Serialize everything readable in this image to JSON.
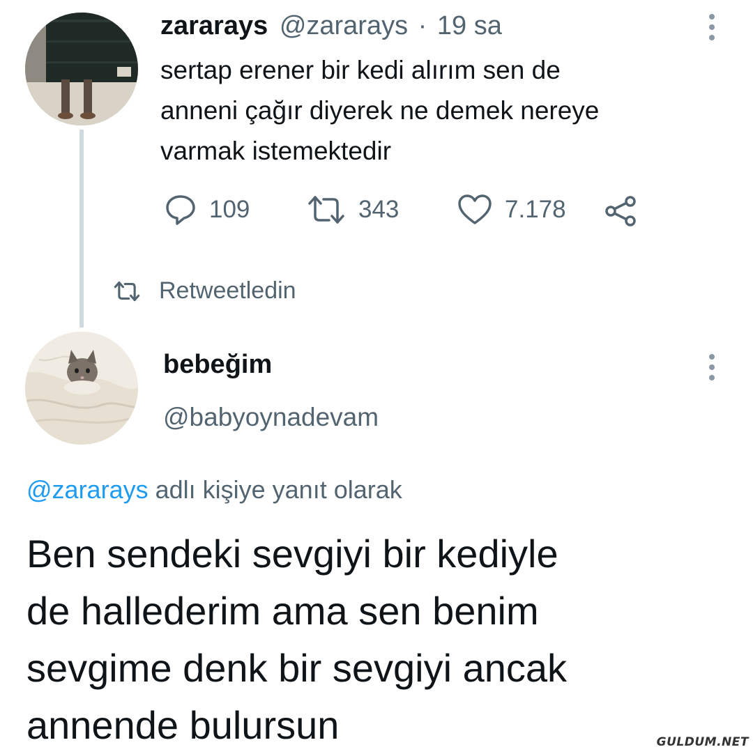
{
  "tweet1": {
    "display_name": "zararays",
    "handle": "@zararays",
    "separator": "·",
    "time": "19 sa",
    "text_lines": [
      "sertap erener bir kedi alırım sen de",
      "anneni çağır diyerek ne demek nereye",
      "varmak istemektedir"
    ],
    "replies": "109",
    "retweets": "343",
    "likes": "7.178",
    "icons": {
      "reply": "reply-icon",
      "retweet": "retweet-icon",
      "like": "heart-icon",
      "share": "share-icon",
      "more": "more-icon"
    }
  },
  "retweet_context": {
    "label": "Retweetledin",
    "icon": "retweet-icon"
  },
  "tweet2": {
    "display_name": "bebeğim",
    "handle": "@babyoynadevam",
    "reply_to": {
      "mention": "@zararays",
      "suffix": " adlı kişiye yanıt olarak"
    },
    "text_lines": [
      "Ben sendeki sevgiyi bir kediyle",
      "de hallederim ama sen benim",
      "sevgime denk bir sevgiyi ancak",
      "annende bulursun"
    ]
  },
  "watermark": "GULDUM.NET",
  "colors": {
    "text": "#0f1419",
    "muted": "#536471",
    "link": "#1d9bf0",
    "thread_line": "#cfd9de"
  }
}
